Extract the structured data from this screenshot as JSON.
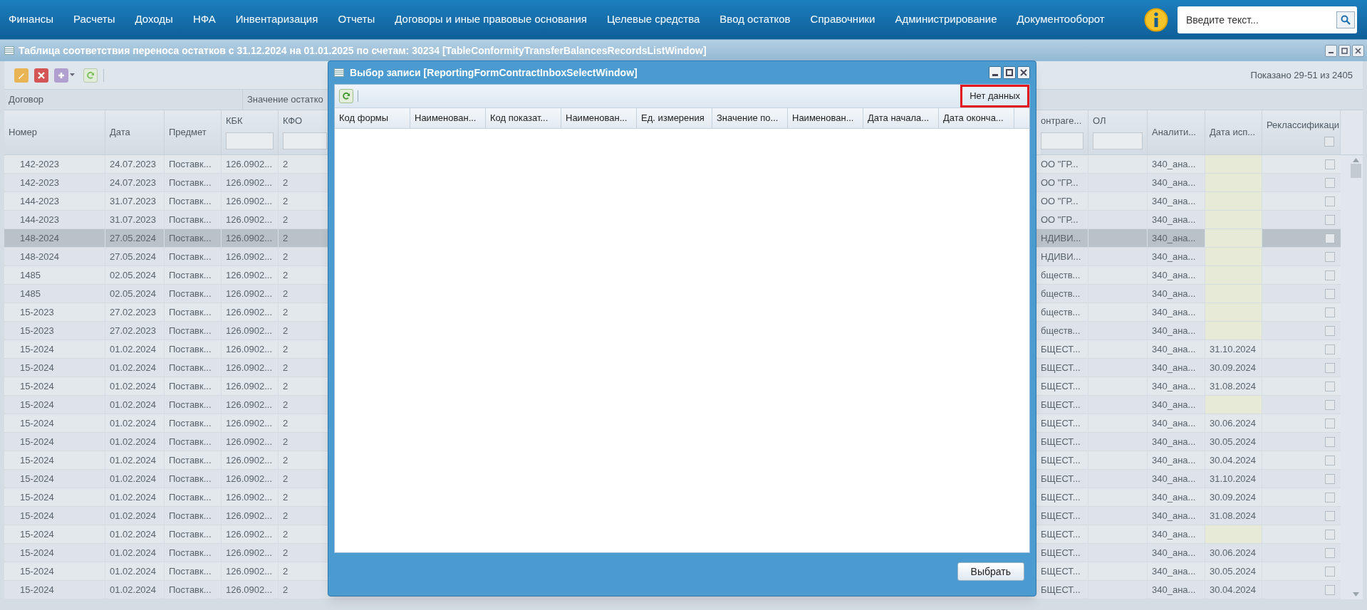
{
  "nav": {
    "items": [
      "Финансы",
      "Расчеты",
      "Доходы",
      "НФА",
      "Инвентаризация",
      "Отчеты",
      "Договоры и иные правовые основания",
      "Целевые средства",
      "Ввод остатков",
      "Справочники",
      "Администрирование",
      "Документооборот"
    ],
    "search": {
      "placeholder": "Введите текст..."
    }
  },
  "window": {
    "title": "Таблица соответствия переноса остатков с 31.12.2024 на 01.01.2025 по счетам: 30234 [TableConformityTransferBalancesRecordsListWindow]"
  },
  "toolbar": {
    "paging": "Показано 29-51 из 2405"
  },
  "grid": {
    "groups": [
      "Договор",
      "Значение остатко"
    ],
    "left_columns": [
      {
        "label": "Номер",
        "filter": false
      },
      {
        "label": "Дата",
        "filter": false
      },
      {
        "label": "Предмет",
        "filter": false
      },
      {
        "label": "КБК",
        "filter": true
      },
      {
        "label": "КФО",
        "filter": true
      }
    ],
    "right_columns": [
      {
        "label": "онтраге...",
        "filter": true
      },
      {
        "label": "ОЛ",
        "filter": true
      },
      {
        "label": "Аналити...",
        "filter": false
      },
      {
        "label": "Дата исп...",
        "filter": false
      },
      {
        "label": "Реклассификаци",
        "filter": false,
        "checkbox": {
          "checked": false
        }
      }
    ],
    "rows": [
      {
        "number": "142-2023",
        "date": "24.07.2023",
        "subject": "Поставк...",
        "kbk": "126.0902...",
        "kfo": "2",
        "contractor": "ОО \"ГР...",
        "analytic": "340_ана...",
        "exec_date": "",
        "checked": false,
        "selected": false
      },
      {
        "number": "142-2023",
        "date": "24.07.2023",
        "subject": "Поставк...",
        "kbk": "126.0902...",
        "kfo": "2",
        "contractor": "ОО \"ГР...",
        "analytic": "340_ана...",
        "exec_date": "",
        "checked": false,
        "selected": false
      },
      {
        "number": "144-2023",
        "date": "31.07.2023",
        "subject": "Поставк...",
        "kbk": "126.0902...",
        "kfo": "2",
        "contractor": "ОО \"ГР...",
        "analytic": "340_ана...",
        "exec_date": "",
        "checked": false,
        "selected": false
      },
      {
        "number": "144-2023",
        "date": "31.07.2023",
        "subject": "Поставк...",
        "kbk": "126.0902...",
        "kfo": "2",
        "contractor": "ОО \"ГР...",
        "analytic": "340_ана...",
        "exec_date": "",
        "checked": false,
        "selected": false
      },
      {
        "number": "148-2024",
        "date": "27.05.2024",
        "subject": "Поставк...",
        "kbk": "126.0902...",
        "kfo": "2",
        "contractor": "НДИВИ...",
        "analytic": "340_ана...",
        "exec_date": "",
        "checked": false,
        "selected": true
      },
      {
        "number": "148-2024",
        "date": "27.05.2024",
        "subject": "Поставк...",
        "kbk": "126.0902...",
        "kfo": "2",
        "contractor": "НДИВИ...",
        "analytic": "340_ана...",
        "exec_date": "",
        "checked": false,
        "selected": false
      },
      {
        "number": "1485",
        "date": "02.05.2024",
        "subject": "Поставк...",
        "kbk": "126.0902...",
        "kfo": "2",
        "contractor": "бществ...",
        "analytic": "340_ана...",
        "exec_date": "",
        "checked": false,
        "selected": false
      },
      {
        "number": "1485",
        "date": "02.05.2024",
        "subject": "Поставк...",
        "kbk": "126.0902...",
        "kfo": "2",
        "contractor": "бществ...",
        "analytic": "340_ана...",
        "exec_date": "",
        "checked": false,
        "selected": false
      },
      {
        "number": "15-2023",
        "date": "27.02.2023",
        "subject": "Поставк...",
        "kbk": "126.0902...",
        "kfo": "2",
        "contractor": "бществ...",
        "analytic": "340_ана...",
        "exec_date": "",
        "checked": false,
        "selected": false
      },
      {
        "number": "15-2023",
        "date": "27.02.2023",
        "subject": "Поставк...",
        "kbk": "126.0902...",
        "kfo": "2",
        "contractor": "бществ...",
        "analytic": "340_ана...",
        "exec_date": "",
        "checked": false,
        "selected": false
      },
      {
        "number": "15-2024",
        "date": "01.02.2024",
        "subject": "Поставк...",
        "kbk": "126.0902...",
        "kfo": "2",
        "contractor": "БЩЕСТ...",
        "analytic": "340_ана...",
        "exec_date": "31.10.2024",
        "checked": false,
        "selected": false
      },
      {
        "number": "15-2024",
        "date": "01.02.2024",
        "subject": "Поставк...",
        "kbk": "126.0902...",
        "kfo": "2",
        "contractor": "БЩЕСТ...",
        "analytic": "340_ана...",
        "exec_date": "30.09.2024",
        "checked": false,
        "selected": false
      },
      {
        "number": "15-2024",
        "date": "01.02.2024",
        "subject": "Поставк...",
        "kbk": "126.0902...",
        "kfo": "2",
        "contractor": "БЩЕСТ...",
        "analytic": "340_ана...",
        "exec_date": "31.08.2024",
        "checked": false,
        "selected": false
      },
      {
        "number": "15-2024",
        "date": "01.02.2024",
        "subject": "Поставк...",
        "kbk": "126.0902...",
        "kfo": "2",
        "contractor": "БЩЕСТ...",
        "analytic": "340_ана...",
        "exec_date": "",
        "checked": false,
        "selected": false
      },
      {
        "number": "15-2024",
        "date": "01.02.2024",
        "subject": "Поставк...",
        "kbk": "126.0902...",
        "kfo": "2",
        "contractor": "БЩЕСТ...",
        "analytic": "340_ана...",
        "exec_date": "30.06.2024",
        "checked": false,
        "selected": false
      },
      {
        "number": "15-2024",
        "date": "01.02.2024",
        "subject": "Поставк...",
        "kbk": "126.0902...",
        "kfo": "2",
        "contractor": "БЩЕСТ...",
        "analytic": "340_ана...",
        "exec_date": "30.05.2024",
        "checked": false,
        "selected": false
      },
      {
        "number": "15-2024",
        "date": "01.02.2024",
        "subject": "Поставк...",
        "kbk": "126.0902...",
        "kfo": "2",
        "contractor": "БЩЕСТ...",
        "analytic": "340_ана...",
        "exec_date": "30.04.2024",
        "checked": false,
        "selected": false
      },
      {
        "number": "15-2024",
        "date": "01.02.2024",
        "subject": "Поставк...",
        "kbk": "126.0902...",
        "kfo": "2",
        "contractor": "БЩЕСТ...",
        "analytic": "340_ана...",
        "exec_date": "31.10.2024",
        "checked": false,
        "selected": false
      },
      {
        "number": "15-2024",
        "date": "01.02.2024",
        "subject": "Поставк...",
        "kbk": "126.0902...",
        "kfo": "2",
        "contractor": "БЩЕСТ...",
        "analytic": "340_ана...",
        "exec_date": "30.09.2024",
        "checked": false,
        "selected": false
      },
      {
        "number": "15-2024",
        "date": "01.02.2024",
        "subject": "Поставк...",
        "kbk": "126.0902...",
        "kfo": "2",
        "contractor": "БЩЕСТ...",
        "analytic": "340_ана...",
        "exec_date": "31.08.2024",
        "checked": false,
        "selected": false
      },
      {
        "number": "15-2024",
        "date": "01.02.2024",
        "subject": "Поставк...",
        "kbk": "126.0902...",
        "kfo": "2",
        "contractor": "БЩЕСТ...",
        "analytic": "340_ана...",
        "exec_date": "",
        "checked": false,
        "selected": false
      },
      {
        "number": "15-2024",
        "date": "01.02.2024",
        "subject": "Поставк...",
        "kbk": "126.0902...",
        "kfo": "2",
        "contractor": "БЩЕСТ...",
        "analytic": "340_ана...",
        "exec_date": "30.06.2024",
        "checked": false,
        "selected": false
      },
      {
        "number": "15-2024",
        "date": "01.02.2024",
        "subject": "Поставк...",
        "kbk": "126.0902...",
        "kfo": "2",
        "contractor": "БЩЕСТ...",
        "analytic": "340_ана...",
        "exec_date": "30.05.2024",
        "checked": false,
        "selected": false
      },
      {
        "number": "15-2024",
        "date": "01.02.2024",
        "subject": "Поставк...",
        "kbk": "126.0902...",
        "kfo": "2",
        "contractor": "БЩЕСТ...",
        "analytic": "340_ана...",
        "exec_date": "30.04.2024",
        "checked": false,
        "selected": false
      }
    ]
  },
  "modal": {
    "title": "Выбор записи [ReportingFormContractInboxSelectWindow]",
    "no_data": "Нет данных",
    "columns": [
      "Код формы",
      "Наименован...",
      "Код показат...",
      "Наименован...",
      "Ед. измерения",
      "Значение по...",
      "Наименован...",
      "Дата начала...",
      "Дата оконча..."
    ],
    "button": "Выбрать"
  }
}
